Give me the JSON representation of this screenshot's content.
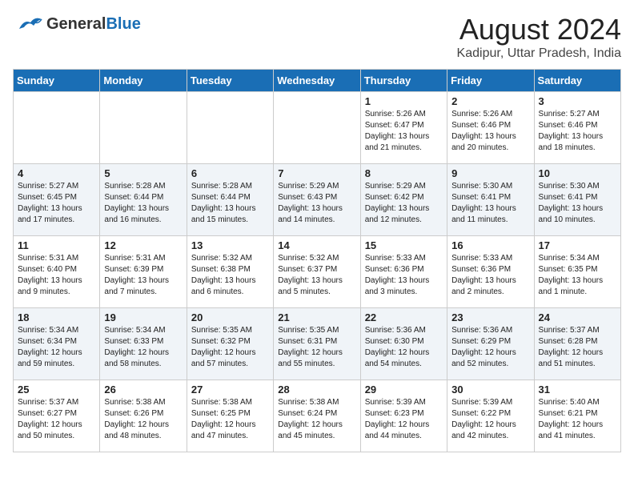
{
  "header": {
    "logo_general": "General",
    "logo_blue": "Blue",
    "month": "August 2024",
    "location": "Kadipur, Uttar Pradesh, India"
  },
  "days_of_week": [
    "Sunday",
    "Monday",
    "Tuesday",
    "Wednesday",
    "Thursday",
    "Friday",
    "Saturday"
  ],
  "weeks": [
    [
      {
        "day": "",
        "text": ""
      },
      {
        "day": "",
        "text": ""
      },
      {
        "day": "",
        "text": ""
      },
      {
        "day": "",
        "text": ""
      },
      {
        "day": "1",
        "text": "Sunrise: 5:26 AM\nSunset: 6:47 PM\nDaylight: 13 hours\nand 21 minutes."
      },
      {
        "day": "2",
        "text": "Sunrise: 5:26 AM\nSunset: 6:46 PM\nDaylight: 13 hours\nand 20 minutes."
      },
      {
        "day": "3",
        "text": "Sunrise: 5:27 AM\nSunset: 6:46 PM\nDaylight: 13 hours\nand 18 minutes."
      }
    ],
    [
      {
        "day": "4",
        "text": "Sunrise: 5:27 AM\nSunset: 6:45 PM\nDaylight: 13 hours\nand 17 minutes."
      },
      {
        "day": "5",
        "text": "Sunrise: 5:28 AM\nSunset: 6:44 PM\nDaylight: 13 hours\nand 16 minutes."
      },
      {
        "day": "6",
        "text": "Sunrise: 5:28 AM\nSunset: 6:44 PM\nDaylight: 13 hours\nand 15 minutes."
      },
      {
        "day": "7",
        "text": "Sunrise: 5:29 AM\nSunset: 6:43 PM\nDaylight: 13 hours\nand 14 minutes."
      },
      {
        "day": "8",
        "text": "Sunrise: 5:29 AM\nSunset: 6:42 PM\nDaylight: 13 hours\nand 12 minutes."
      },
      {
        "day": "9",
        "text": "Sunrise: 5:30 AM\nSunset: 6:41 PM\nDaylight: 13 hours\nand 11 minutes."
      },
      {
        "day": "10",
        "text": "Sunrise: 5:30 AM\nSunset: 6:41 PM\nDaylight: 13 hours\nand 10 minutes."
      }
    ],
    [
      {
        "day": "11",
        "text": "Sunrise: 5:31 AM\nSunset: 6:40 PM\nDaylight: 13 hours\nand 9 minutes."
      },
      {
        "day": "12",
        "text": "Sunrise: 5:31 AM\nSunset: 6:39 PM\nDaylight: 13 hours\nand 7 minutes."
      },
      {
        "day": "13",
        "text": "Sunrise: 5:32 AM\nSunset: 6:38 PM\nDaylight: 13 hours\nand 6 minutes."
      },
      {
        "day": "14",
        "text": "Sunrise: 5:32 AM\nSunset: 6:37 PM\nDaylight: 13 hours\nand 5 minutes."
      },
      {
        "day": "15",
        "text": "Sunrise: 5:33 AM\nSunset: 6:36 PM\nDaylight: 13 hours\nand 3 minutes."
      },
      {
        "day": "16",
        "text": "Sunrise: 5:33 AM\nSunset: 6:36 PM\nDaylight: 13 hours\nand 2 minutes."
      },
      {
        "day": "17",
        "text": "Sunrise: 5:34 AM\nSunset: 6:35 PM\nDaylight: 13 hours\nand 1 minute."
      }
    ],
    [
      {
        "day": "18",
        "text": "Sunrise: 5:34 AM\nSunset: 6:34 PM\nDaylight: 12 hours\nand 59 minutes."
      },
      {
        "day": "19",
        "text": "Sunrise: 5:34 AM\nSunset: 6:33 PM\nDaylight: 12 hours\nand 58 minutes."
      },
      {
        "day": "20",
        "text": "Sunrise: 5:35 AM\nSunset: 6:32 PM\nDaylight: 12 hours\nand 57 minutes."
      },
      {
        "day": "21",
        "text": "Sunrise: 5:35 AM\nSunset: 6:31 PM\nDaylight: 12 hours\nand 55 minutes."
      },
      {
        "day": "22",
        "text": "Sunrise: 5:36 AM\nSunset: 6:30 PM\nDaylight: 12 hours\nand 54 minutes."
      },
      {
        "day": "23",
        "text": "Sunrise: 5:36 AM\nSunset: 6:29 PM\nDaylight: 12 hours\nand 52 minutes."
      },
      {
        "day": "24",
        "text": "Sunrise: 5:37 AM\nSunset: 6:28 PM\nDaylight: 12 hours\nand 51 minutes."
      }
    ],
    [
      {
        "day": "25",
        "text": "Sunrise: 5:37 AM\nSunset: 6:27 PM\nDaylight: 12 hours\nand 50 minutes."
      },
      {
        "day": "26",
        "text": "Sunrise: 5:38 AM\nSunset: 6:26 PM\nDaylight: 12 hours\nand 48 minutes."
      },
      {
        "day": "27",
        "text": "Sunrise: 5:38 AM\nSunset: 6:25 PM\nDaylight: 12 hours\nand 47 minutes."
      },
      {
        "day": "28",
        "text": "Sunrise: 5:38 AM\nSunset: 6:24 PM\nDaylight: 12 hours\nand 45 minutes."
      },
      {
        "day": "29",
        "text": "Sunrise: 5:39 AM\nSunset: 6:23 PM\nDaylight: 12 hours\nand 44 minutes."
      },
      {
        "day": "30",
        "text": "Sunrise: 5:39 AM\nSunset: 6:22 PM\nDaylight: 12 hours\nand 42 minutes."
      },
      {
        "day": "31",
        "text": "Sunrise: 5:40 AM\nSunset: 6:21 PM\nDaylight: 12 hours\nand 41 minutes."
      }
    ]
  ]
}
